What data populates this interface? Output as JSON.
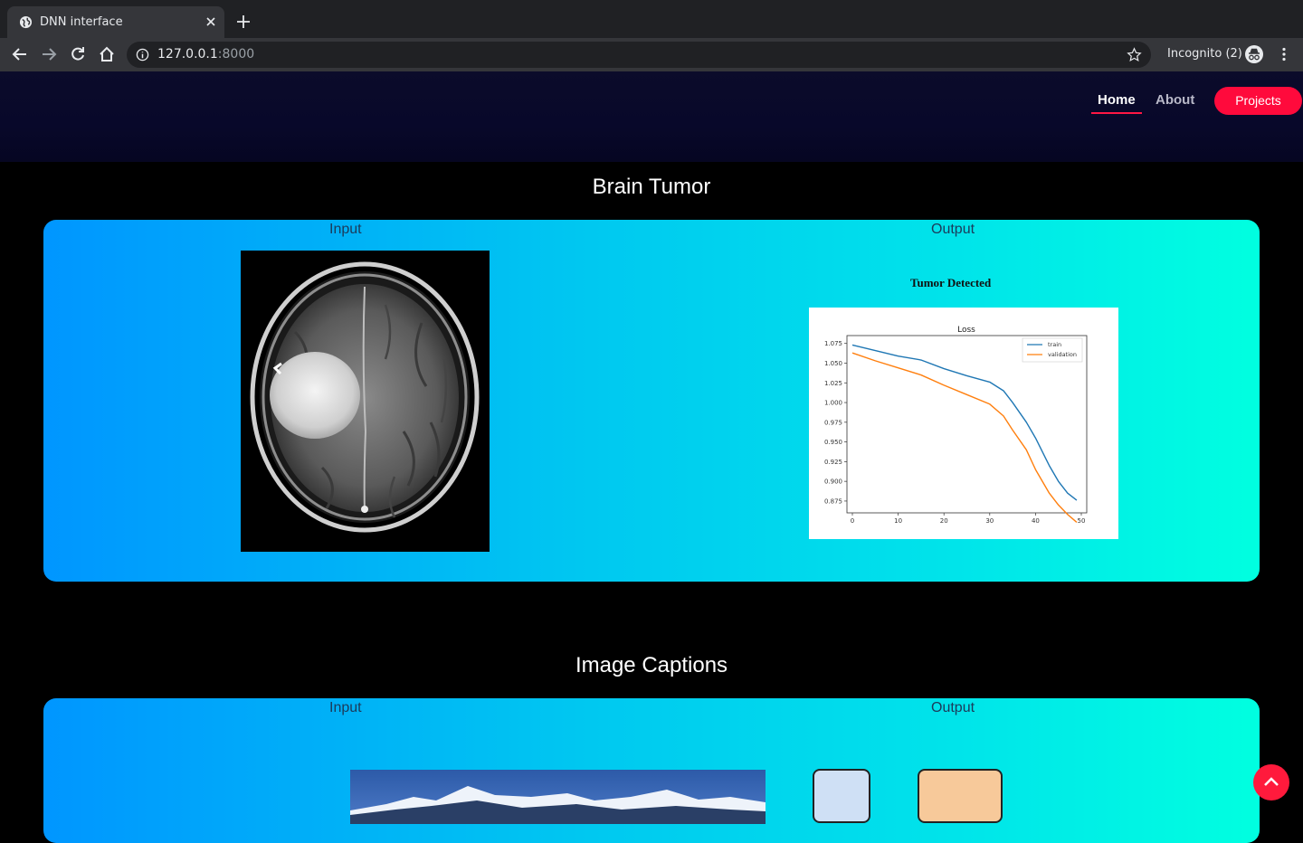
{
  "browser": {
    "tab_title": "DNN interface",
    "url_host": "127.0.0.1",
    "url_port": ":8000",
    "incognito_label": "Incognito (2)"
  },
  "nav": {
    "home": "Home",
    "about": "About",
    "projects": "Projects"
  },
  "sections": [
    {
      "title": "Brain Tumor",
      "input_label": "Input",
      "output_label": "Output",
      "result_text": "Tumor Detected"
    },
    {
      "title": "Image Captions",
      "input_label": "Input",
      "output_label": "Output"
    }
  ],
  "colors": {
    "accent": "#ff0a3c",
    "panel_start": "#0096ff",
    "panel_end": "#00ffe0"
  },
  "chart_data": {
    "type": "line",
    "title": "Loss",
    "xlabel": "",
    "ylabel": "",
    "x_ticks": [
      0,
      10,
      20,
      30,
      40,
      50
    ],
    "y_ticks": [
      "0.875",
      "0.900",
      "0.925",
      "0.950",
      "0.975",
      "1.000",
      "1.025",
      "1.050",
      "1.075"
    ],
    "xlim": [
      0,
      50
    ],
    "ylim": [
      0.86,
      1.085
    ],
    "legend_position": "top-right",
    "x": [
      0,
      5,
      10,
      15,
      20,
      25,
      30,
      33,
      35,
      38,
      40,
      43,
      45,
      47,
      49
    ],
    "series": [
      {
        "name": "train",
        "color": "#1f77b4",
        "values": [
          1.073,
          1.066,
          1.059,
          1.054,
          1.043,
          1.034,
          1.026,
          1.015,
          1.0,
          0.975,
          0.955,
          0.92,
          0.9,
          0.885,
          0.876
        ]
      },
      {
        "name": "validation",
        "color": "#ff7f0e",
        "values": [
          1.063,
          1.053,
          1.044,
          1.035,
          1.022,
          1.01,
          0.998,
          0.983,
          0.965,
          0.94,
          0.915,
          0.885,
          0.87,
          0.858,
          0.848
        ]
      }
    ]
  }
}
